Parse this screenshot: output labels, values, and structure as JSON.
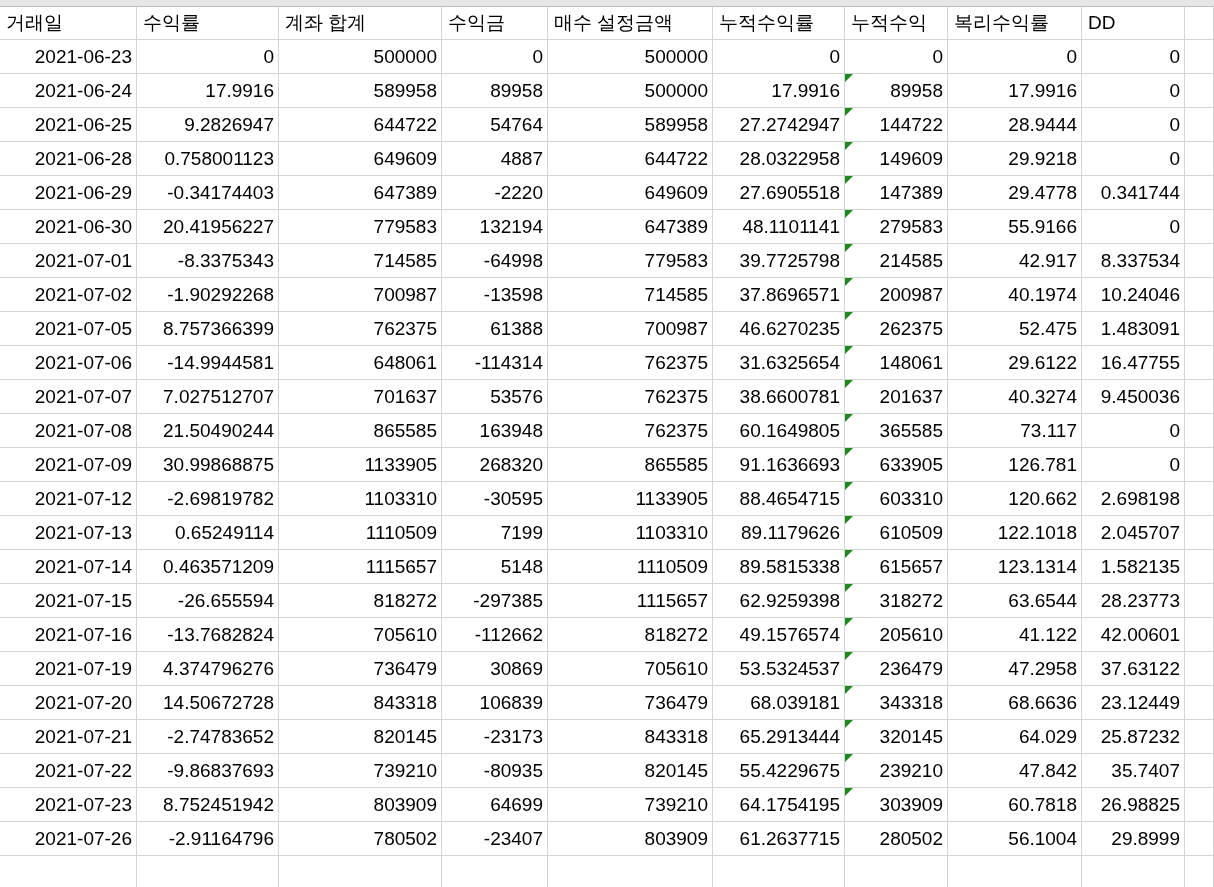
{
  "columns": [
    "거래일",
    "수익률",
    "계좌 합계",
    "수익금",
    "매수 설정금액",
    "누적수익률",
    "누적수익",
    "복리수익률",
    "DD"
  ],
  "rows": [
    {
      "cells": [
        "2021-06-23",
        "0",
        "500000",
        "0",
        "500000",
        "0",
        "0",
        "0",
        "0"
      ],
      "flagged": false
    },
    {
      "cells": [
        "2021-06-24",
        "17.9916",
        "589958",
        "89958",
        "500000",
        "17.9916",
        "89958",
        "17.9916",
        "0"
      ],
      "flagged": true
    },
    {
      "cells": [
        "2021-06-25",
        "9.2826947",
        "644722",
        "54764",
        "589958",
        "27.2742947",
        "144722",
        "28.9444",
        "0"
      ],
      "flagged": true
    },
    {
      "cells": [
        "2021-06-28",
        "0.758001123",
        "649609",
        "4887",
        "644722",
        "28.0322958",
        "149609",
        "29.9218",
        "0"
      ],
      "flagged": true
    },
    {
      "cells": [
        "2021-06-29",
        "-0.34174403",
        "647389",
        "-2220",
        "649609",
        "27.6905518",
        "147389",
        "29.4778",
        "0.341744"
      ],
      "flagged": true
    },
    {
      "cells": [
        "2021-06-30",
        "20.41956227",
        "779583",
        "132194",
        "647389",
        "48.1101141",
        "279583",
        "55.9166",
        "0"
      ],
      "flagged": true
    },
    {
      "cells": [
        "2021-07-01",
        "-8.3375343",
        "714585",
        "-64998",
        "779583",
        "39.7725798",
        "214585",
        "42.917",
        "8.337534"
      ],
      "flagged": true
    },
    {
      "cells": [
        "2021-07-02",
        "-1.90292268",
        "700987",
        "-13598",
        "714585",
        "37.8696571",
        "200987",
        "40.1974",
        "10.24046"
      ],
      "flagged": true
    },
    {
      "cells": [
        "2021-07-05",
        "8.757366399",
        "762375",
        "61388",
        "700987",
        "46.6270235",
        "262375",
        "52.475",
        "1.483091"
      ],
      "flagged": true
    },
    {
      "cells": [
        "2021-07-06",
        "-14.9944581",
        "648061",
        "-114314",
        "762375",
        "31.6325654",
        "148061",
        "29.6122",
        "16.47755"
      ],
      "flagged": true
    },
    {
      "cells": [
        "2021-07-07",
        "7.027512707",
        "701637",
        "53576",
        "762375",
        "38.6600781",
        "201637",
        "40.3274",
        "9.450036"
      ],
      "flagged": true
    },
    {
      "cells": [
        "2021-07-08",
        "21.50490244",
        "865585",
        "163948",
        "762375",
        "60.1649805",
        "365585",
        "73.117",
        "0"
      ],
      "flagged": true
    },
    {
      "cells": [
        "2021-07-09",
        "30.99868875",
        "1133905",
        "268320",
        "865585",
        "91.1636693",
        "633905",
        "126.781",
        "0"
      ],
      "flagged": true
    },
    {
      "cells": [
        "2021-07-12",
        "-2.69819782",
        "1103310",
        "-30595",
        "1133905",
        "88.4654715",
        "603310",
        "120.662",
        "2.698198"
      ],
      "flagged": true
    },
    {
      "cells": [
        "2021-07-13",
        "0.65249114",
        "1110509",
        "7199",
        "1103310",
        "89.1179626",
        "610509",
        "122.1018",
        "2.045707"
      ],
      "flagged": true
    },
    {
      "cells": [
        "2021-07-14",
        "0.463571209",
        "1115657",
        "5148",
        "1110509",
        "89.5815338",
        "615657",
        "123.1314",
        "1.582135"
      ],
      "flagged": true
    },
    {
      "cells": [
        "2021-07-15",
        "-26.655594",
        "818272",
        "-297385",
        "1115657",
        "62.9259398",
        "318272",
        "63.6544",
        "28.23773"
      ],
      "flagged": true
    },
    {
      "cells": [
        "2021-07-16",
        "-13.7682824",
        "705610",
        "-112662",
        "818272",
        "49.1576574",
        "205610",
        "41.122",
        "42.00601"
      ],
      "flagged": true
    },
    {
      "cells": [
        "2021-07-19",
        "4.374796276",
        "736479",
        "30869",
        "705610",
        "53.5324537",
        "236479",
        "47.2958",
        "37.63122"
      ],
      "flagged": true
    },
    {
      "cells": [
        "2021-07-20",
        "14.50672728",
        "843318",
        "106839",
        "736479",
        "68.039181",
        "343318",
        "68.6636",
        "23.12449"
      ],
      "flagged": true
    },
    {
      "cells": [
        "2021-07-21",
        "-2.74783652",
        "820145",
        "-23173",
        "843318",
        "65.2913444",
        "320145",
        "64.029",
        "25.87232"
      ],
      "flagged": true
    },
    {
      "cells": [
        "2021-07-22",
        "-9.86837693",
        "739210",
        "-80935",
        "820145",
        "55.4229675",
        "239210",
        "47.842",
        "35.7407"
      ],
      "flagged": true
    },
    {
      "cells": [
        "2021-07-23",
        "8.752451942",
        "803909",
        "64699",
        "739210",
        "64.1754195",
        "303909",
        "60.7818",
        "26.98825"
      ],
      "flagged": true
    },
    {
      "cells": [
        "2021-07-26",
        "-2.91164796",
        "780502",
        "-23407",
        "803909",
        "61.2637715",
        "280502",
        "56.1004",
        "29.8999"
      ],
      "flagged": false
    }
  ]
}
